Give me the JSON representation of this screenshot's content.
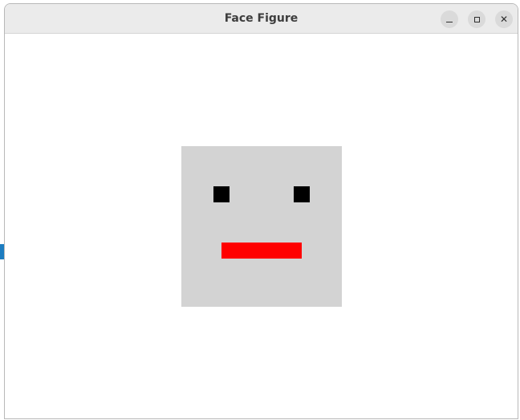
{
  "window": {
    "title": "Face Figure",
    "controls": {
      "minimize_icon": "minimize-icon",
      "maximize_icon": "maximize-icon",
      "close_icon": "close-icon",
      "close_glyph": "✕"
    }
  },
  "face": {
    "background_color": "#d3d3d3",
    "eye_color": "#000000",
    "mouth_color": "#ff0000"
  }
}
